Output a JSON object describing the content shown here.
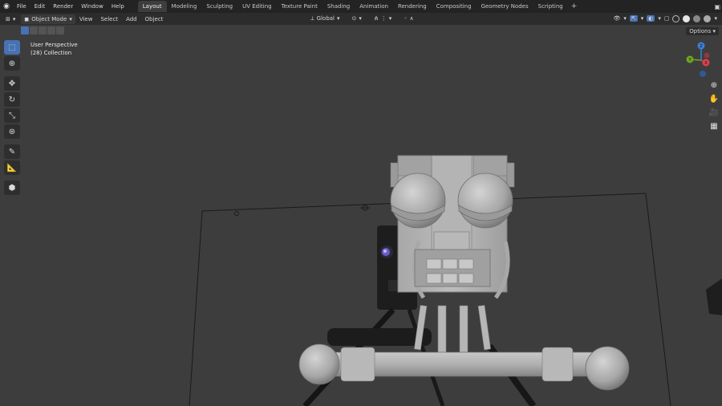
{
  "menubar": {
    "items": [
      "File",
      "Edit",
      "Render",
      "Window",
      "Help"
    ]
  },
  "workspaces": {
    "tabs": [
      "Layout",
      "Modeling",
      "Sculpting",
      "UV Editing",
      "Texture Paint",
      "Shading",
      "Animation",
      "Rendering",
      "Compositing",
      "Geometry Nodes",
      "Scripting"
    ],
    "active": "Layout",
    "add": "+"
  },
  "viewport_header": {
    "mode": "Object Mode",
    "menus": [
      "View",
      "Select",
      "Add",
      "Object"
    ],
    "transform_orientation": "Global"
  },
  "overlay": {
    "view_name": "User Perspective",
    "collection": "(28) Collection"
  },
  "nav": {
    "options_label": "Options",
    "gizmo_y": "Y",
    "gizmo_x": "X",
    "gizmo_z": "Z"
  },
  "colors": {
    "accent": "#4772b3",
    "axis_x": "#e0414d",
    "axis_y": "#6ea521",
    "axis_z": "#3c80d8",
    "viewport_bg": "#3d3d3d"
  },
  "icons": {
    "tools": [
      "select-box-icon",
      "cursor-icon",
      "move-icon",
      "rotate-icon",
      "scale-icon",
      "transform-icon",
      "annotate-icon",
      "measure-icon",
      "add-cube-icon"
    ]
  }
}
